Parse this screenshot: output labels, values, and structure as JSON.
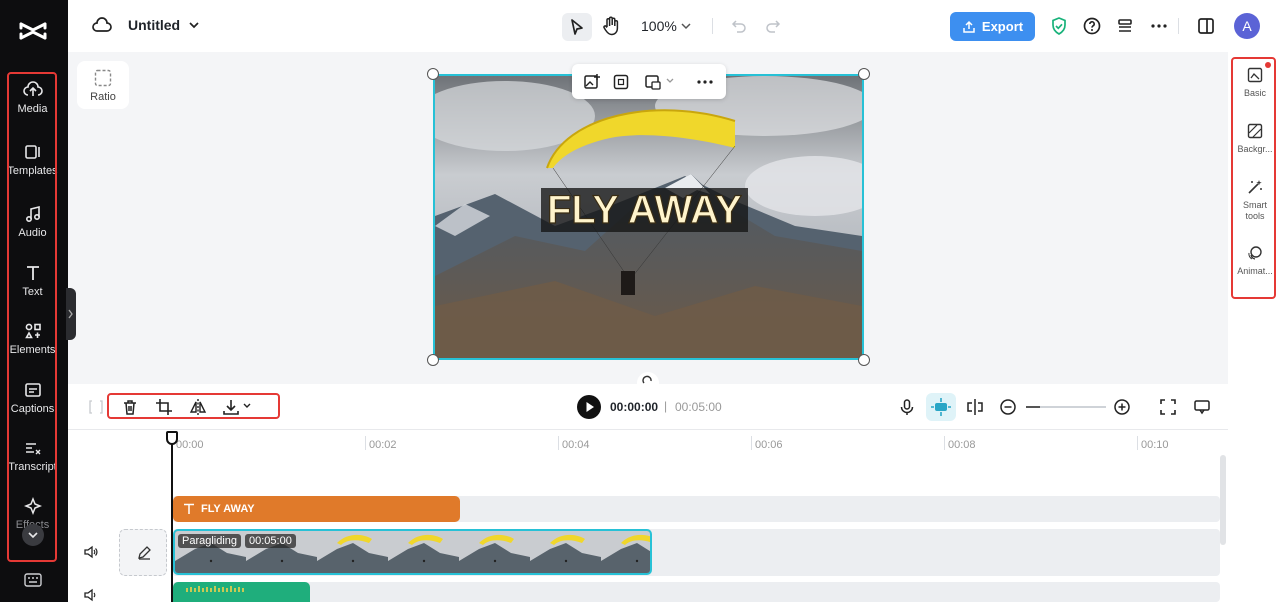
{
  "app": {
    "project_title": "Untitled"
  },
  "sidebar": {
    "items": [
      {
        "label": "Media",
        "icon": "cloud-upload-icon"
      },
      {
        "label": "Templates",
        "icon": "templates-icon"
      },
      {
        "label": "Audio",
        "icon": "music-note-icon"
      },
      {
        "label": "Text",
        "icon": "text-t-icon"
      },
      {
        "label": "Elements",
        "icon": "elements-icon"
      },
      {
        "label": "Captions",
        "icon": "captions-icon"
      },
      {
        "label": "Transcript",
        "icon": "transcript-icon"
      },
      {
        "label": "Effects",
        "icon": "sparkle-icon"
      }
    ]
  },
  "topbar": {
    "zoom": "100%",
    "export_label": "Export",
    "avatar_initial": "A"
  },
  "ratio": {
    "label": "Ratio"
  },
  "canvas": {
    "headline": "FLY AWAY"
  },
  "right_panel": {
    "items": [
      {
        "label": "Basic",
        "icon": "basic-icon"
      },
      {
        "label": "Backgr...",
        "icon": "background-icon"
      },
      {
        "label": "Smart tools",
        "icon": "magic-wand-icon"
      },
      {
        "label": "Animat...",
        "icon": "animation-icon"
      }
    ]
  },
  "playback": {
    "current_time": "00:00:00",
    "separator": "|",
    "total_time": "00:05:00"
  },
  "ruler": [
    "00:00",
    "00:02",
    "00:04",
    "00:06",
    "00:08",
    "00:10"
  ],
  "tracks": {
    "text_clip": "FLY AWAY",
    "video_clip_name": "Paragliding",
    "video_clip_duration": "00:05:00"
  },
  "colors": {
    "accent": "#3d8ff0",
    "selection": "#27c1d6",
    "text_clip": "#e07a2a",
    "audio_clip": "#1fae7c",
    "highlight_box": "#e53935"
  }
}
